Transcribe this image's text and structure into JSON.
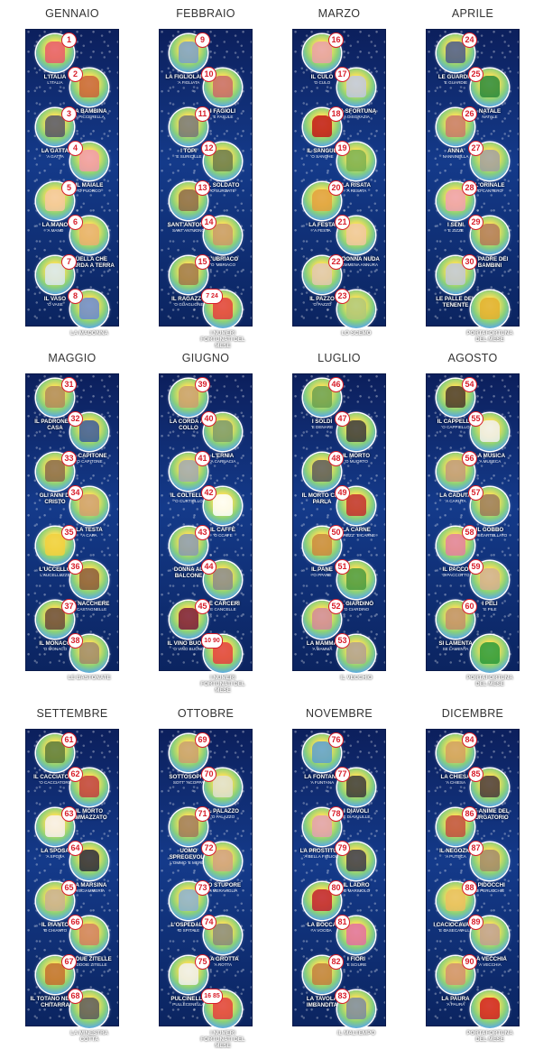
{
  "months": [
    {
      "name": "GENNAIO",
      "items": [
        {
          "num": "1",
          "label": "L'ITALIA",
          "sub": "L'ITALIA",
          "icon": "italy-icon",
          "color": "#e65b6b"
        },
        {
          "num": "2",
          "label": "LA BAMBINA",
          "sub": "'A PICCERELLA",
          "icon": "girl-icon",
          "color": "#c8643a"
        },
        {
          "num": "3",
          "label": "LA GATTA",
          "sub": "'A GATTA",
          "icon": "cat-icon",
          "color": "#555566"
        },
        {
          "num": "4",
          "label": "IL MAIALE",
          "sub": "'O PUORCO",
          "icon": "pig-icon",
          "color": "#f09aaa"
        },
        {
          "num": "5",
          "label": "LA MANO",
          "sub": "'A MANO",
          "icon": "hand-icon",
          "color": "#f4c8a0"
        },
        {
          "num": "6",
          "label": "QUELLA CHE GUARDA A TERRA",
          "sub": "",
          "icon": "woman-icon",
          "color": "#e8b070"
        },
        {
          "num": "7",
          "label": "IL VASO",
          "sub": "'O VASE",
          "icon": "vase-icon",
          "color": "#d8e8f0"
        },
        {
          "num": "8",
          "label": "LA MADONNA",
          "sub": "'A MARONNA",
          "icon": "madonna-icon",
          "color": "#6a8ad0"
        }
      ]
    },
    {
      "name": "FEBBRAIO",
      "items": [
        {
          "num": "9",
          "label": "LA FIGLIOLANZA",
          "sub": "'A FIGLIATA",
          "icon": "family-icon",
          "color": "#7aa0c8"
        },
        {
          "num": "10",
          "label": "I FAGIOLI",
          "sub": "'E FASULE",
          "icon": "beans-icon",
          "color": "#c86a6a"
        },
        {
          "num": "11",
          "label": "I TOPI",
          "sub": "'E SURICILLE",
          "icon": "mouse-icon",
          "color": "#777777"
        },
        {
          "num": "12",
          "label": "IL SOLDATO",
          "sub": "'O SURDATE",
          "icon": "soldier-icon",
          "color": "#6a7a4a"
        },
        {
          "num": "13",
          "label": "SANT'ANTONIO",
          "sub": "SANT'ANTUONO",
          "icon": "saint-icon",
          "color": "#8a6a4a"
        },
        {
          "num": "14",
          "label": "L'UBRIACO",
          "sub": "'O 'MBRIACO",
          "icon": "drunk-icon",
          "color": "#c89a6a"
        },
        {
          "num": "15",
          "label": "IL RAGAZZO",
          "sub": "'O GUAGLIONE",
          "icon": "boy-icon",
          "color": "#a0784a"
        },
        {
          "num": "7 24",
          "label": "I NUMERI FORTUNATI DEL MESE",
          "sub": "",
          "icon": "lucky-icon",
          "color": "#e04040"
        }
      ]
    },
    {
      "name": "MARZO",
      "items": [
        {
          "num": "16",
          "label": "IL CULO",
          "sub": "'O CULO",
          "icon": "bottom-icon",
          "color": "#e8a0a8"
        },
        {
          "num": "17",
          "label": "LA SFORTUNA",
          "sub": "'A DISGRAZIA",
          "icon": "misfortune-icon",
          "color": "#c0c8e0"
        },
        {
          "num": "18",
          "label": "IL SANGUE",
          "sub": "'O SANGHE",
          "icon": "blood-icon",
          "color": "#c01818"
        },
        {
          "num": "19",
          "label": "LA RISATA",
          "sub": "'A RESATA",
          "icon": "laugh-icon",
          "color": "#7ab050"
        },
        {
          "num": "20",
          "label": "LA FESTA",
          "sub": "'A FESTA",
          "icon": "party-icon",
          "color": "#e0a040"
        },
        {
          "num": "21",
          "label": "LA DONNA NUDA",
          "sub": "'A FEMMENA ANNURA",
          "icon": "nude-icon",
          "color": "#f0c8a0"
        },
        {
          "num": "22",
          "label": "IL PAZZO",
          "sub": "'O PAZZO",
          "icon": "crazy-icon",
          "color": "#e0c8b0"
        },
        {
          "num": "23",
          "label": "LO SCEMO",
          "sub": "'O SCEMO",
          "icon": "fool-icon",
          "color": "#b0c878"
        }
      ]
    },
    {
      "name": "APRILE",
      "items": [
        {
          "num": "24",
          "label": "LE GUARDIE",
          "sub": "'E GUARDIE",
          "icon": "guards-icon",
          "color": "#4a5a8a"
        },
        {
          "num": "25",
          "label": "NATALE",
          "sub": "NATALE",
          "icon": "christmas-tree-icon",
          "color": "#2a8a3a"
        },
        {
          "num": "26",
          "label": "ANNA",
          "sub": "NANNINELLA",
          "icon": "anna-icon",
          "color": "#c87a6a"
        },
        {
          "num": "27",
          "label": "L'ORINALE",
          "sub": "'O CANTERO",
          "icon": "chamberpot-icon",
          "color": "#a0a0a0"
        },
        {
          "num": "28",
          "label": "I SENI",
          "sub": "'E ZIZZE",
          "icon": "breasts-icon",
          "color": "#f0a0b0"
        },
        {
          "num": "29",
          "label": "IL PADRE DEI BAMBINI",
          "sub": "",
          "icon": "father-icon",
          "color": "#b07a5a"
        },
        {
          "num": "30",
          "label": "LE PALLE DEL TENENTE",
          "sub": "",
          "icon": "balls-icon",
          "color": "#c0c8d8"
        },
        {
          "num": "",
          "label": "PORTAFORTUNA DEL MESE",
          "sub": "",
          "icon": "horseshoe-icon",
          "color": "#e0b030"
        }
      ]
    },
    {
      "name": "MAGGIO",
      "items": [
        {
          "num": "31",
          "label": "IL PADRONE DI CASA",
          "sub": "",
          "icon": "landlord-icon",
          "color": "#b08a5a"
        },
        {
          "num": "32",
          "label": "IL CAPITONE",
          "sub": "'O CAPITONE",
          "icon": "eel-icon",
          "color": "#3a5a9a"
        },
        {
          "num": "33",
          "label": "GLI ANNI DI CRISTO",
          "sub": "",
          "icon": "christ-icon",
          "color": "#8a6a4a"
        },
        {
          "num": "34",
          "label": "LA TESTA",
          "sub": "'A CAPA",
          "icon": "head-icon",
          "color": "#d0a070"
        },
        {
          "num": "35",
          "label": "L'UCCELLO",
          "sub": "L'AUCELLUZZE",
          "icon": "bird-icon",
          "color": "#f0d040"
        },
        {
          "num": "36",
          "label": "LE NACCHERE",
          "sub": "'E CASTAGNELLE",
          "icon": "castanets-icon",
          "color": "#8a5a3a"
        },
        {
          "num": "37",
          "label": "IL MONACO",
          "sub": "'O MONACO",
          "icon": "monk-icon",
          "color": "#6a4a3a"
        },
        {
          "num": "38",
          "label": "LE BASTONATE",
          "sub": "'E MAZZATE",
          "icon": "beating-icon",
          "color": "#a08a6a"
        }
      ]
    },
    {
      "name": "GIUGNO",
      "items": [
        {
          "num": "39",
          "label": "LA CORDA AL COLLO",
          "sub": "",
          "icon": "rope-icon",
          "color": "#c8a070"
        },
        {
          "num": "40",
          "label": "L'ERNIA",
          "sub": "'A CARNACIA",
          "icon": "hernia-icon",
          "color": "#7a9a6a"
        },
        {
          "num": "41",
          "label": "IL COLTELLO",
          "sub": "'O CURTIELLO",
          "icon": "knife-icon",
          "color": "#a0a8b0"
        },
        {
          "num": "42",
          "label": "IL CAFFÈ",
          "sub": "'O CCAFE",
          "icon": "coffee-icon",
          "color": "#ffffff"
        },
        {
          "num": "43",
          "label": "DONNA AL BALCONE",
          "sub": "",
          "icon": "balcony-icon",
          "color": "#8a9ab0"
        },
        {
          "num": "44",
          "label": "LE CARCERI",
          "sub": "'E CANCELLE",
          "icon": "jail-icon",
          "color": "#8a8a8a"
        },
        {
          "num": "45",
          "label": "IL VINO BUONO",
          "sub": "'O VINO BUONO",
          "icon": "wine-icon",
          "color": "#7a1a3a"
        },
        {
          "num": "10 90",
          "label": "I NUMERI FORTUNATI DEL MESE",
          "sub": "",
          "icon": "lucky-icon",
          "color": "#e04040"
        }
      ]
    },
    {
      "name": "LUGLIO",
      "items": [
        {
          "num": "46",
          "label": "I SOLDI",
          "sub": "'E DENARE",
          "icon": "money-icon",
          "color": "#6aa050"
        },
        {
          "num": "47",
          "label": "IL MORTO",
          "sub": "'O MUORTO",
          "icon": "coffin-icon",
          "color": "#3a3a3a"
        },
        {
          "num": "48",
          "label": "IL MORTO CHE PARLA",
          "sub": "",
          "icon": "talking-dead-icon",
          "color": "#5a5a5a"
        },
        {
          "num": "49",
          "label": "LA CARNE",
          "sub": "'O PIEZZ' 'E CARNE",
          "icon": "meat-icon",
          "color": "#c03030"
        },
        {
          "num": "50",
          "label": "IL PANE",
          "sub": "'O PPANE",
          "icon": "bread-icon",
          "color": "#c88a40"
        },
        {
          "num": "51",
          "label": "IL GIARDINO",
          "sub": "'O CIARDINO",
          "icon": "garden-icon",
          "color": "#4a9a40"
        },
        {
          "num": "52",
          "label": "LA MAMMA",
          "sub": "'A MAMMA",
          "icon": "mother-icon",
          "color": "#d08a9a"
        },
        {
          "num": "53",
          "label": "IL VECCHIO",
          "sub": "'O VIECCHIO",
          "icon": "old-man-icon",
          "color": "#b0a090"
        }
      ]
    },
    {
      "name": "AGOSTO",
      "items": [
        {
          "num": "54",
          "label": "IL CAPPELLO",
          "sub": "'O CAPPIELLO",
          "icon": "hat-icon",
          "color": "#4a3a2a"
        },
        {
          "num": "55",
          "label": "LA MUSICA",
          "sub": "'A MUSECA",
          "icon": "music-icon",
          "color": "#f0f0f0"
        },
        {
          "num": "56",
          "label": "LA CADUTA",
          "sub": "'A CARUTA",
          "icon": "fall-icon",
          "color": "#c09a7a"
        },
        {
          "num": "57",
          "label": "IL GOBBO",
          "sub": "'O SCARTELLATO",
          "icon": "hunchback-icon",
          "color": "#9a7a5a"
        },
        {
          "num": "58",
          "label": "IL PACCO",
          "sub": "'O PACCOTTO",
          "icon": "gift-icon",
          "color": "#e080a0"
        },
        {
          "num": "59",
          "label": "I PELI",
          "sub": "'E PILE",
          "icon": "hair-icon",
          "color": "#d0b090"
        },
        {
          "num": "60",
          "label": "SI LAMENTA",
          "sub": "SE LAMENTA",
          "icon": "complain-icon",
          "color": "#c0906a"
        },
        {
          "num": "",
          "label": "PORTAFORTUNA DEL MESE",
          "sub": "",
          "icon": "clover-icon",
          "color": "#2a9a3a"
        }
      ]
    },
    {
      "name": "SETTEMBRE",
      "items": [
        {
          "num": "61",
          "label": "IL CACCIATORE",
          "sub": "'O CACCIATORE",
          "icon": "hunter-icon",
          "color": "#5a7a3a"
        },
        {
          "num": "62",
          "label": "IL MORTO AMMAZZATO",
          "sub": "",
          "icon": "murdered-icon",
          "color": "#c04040"
        },
        {
          "num": "63",
          "label": "LA SPOSA",
          "sub": "'A SPOSA",
          "icon": "bride-icon",
          "color": "#f8f0f0"
        },
        {
          "num": "64",
          "label": "LA MARSINA",
          "sub": "'A SCIAMMERIA",
          "icon": "tailcoat-icon",
          "color": "#2a2a3a"
        },
        {
          "num": "65",
          "label": "IL PIANTO",
          "sub": "'O CHIANTO",
          "icon": "crying-icon",
          "color": "#c8b090"
        },
        {
          "num": "66",
          "label": "LE DUE ZITELLE",
          "sub": "'E DDOIE ZITELLE",
          "icon": "spinsters-icon",
          "color": "#d08060"
        },
        {
          "num": "67",
          "label": "IL TOTANO NELLA CHITARRA",
          "sub": "",
          "icon": "squid-guitar-icon",
          "color": "#c07030"
        },
        {
          "num": "68",
          "label": "LA MINESTRA COTTA",
          "sub": "'A ZUPPA COTTA",
          "icon": "soup-icon",
          "color": "#5a5a5a"
        }
      ]
    },
    {
      "name": "OTTOBRE",
      "items": [
        {
          "num": "69",
          "label": "SOTTOSOPRA",
          "sub": "SOTT' 'NCOPPA",
          "icon": "upside-down-icon",
          "color": "#c8a070"
        },
        {
          "num": "70",
          "label": "IL PALAZZO",
          "sub": "'O PALAZZO",
          "icon": "palace-icon",
          "color": "#e0e0d0"
        },
        {
          "num": "71",
          "label": "UOMO SPREGEVOLE",
          "sub": "L'OMMO 'E MERDA",
          "icon": "despicable-icon",
          "color": "#a07a5a"
        },
        {
          "num": "72",
          "label": "LO STUPORE",
          "sub": "'A MERAVIGLIA",
          "icon": "amazement-icon",
          "color": "#d0a080"
        },
        {
          "num": "73",
          "label": "L'OSPEDALE",
          "sub": "'O SPITALE",
          "icon": "hospital-icon",
          "color": "#8ab0d0"
        },
        {
          "num": "74",
          "label": "LA GROTTA",
          "sub": "'A ROTTA",
          "icon": "cave-icon",
          "color": "#8a8a7a"
        },
        {
          "num": "75",
          "label": "PULCINELLA",
          "sub": "PULLECENELLA",
          "icon": "pulcinella-icon",
          "color": "#f0f0f0"
        },
        {
          "num": "16 85",
          "label": "I NUMERI FORTUNATI DEL MESE",
          "sub": "",
          "icon": "lucky-icon",
          "color": "#e04040"
        }
      ]
    },
    {
      "name": "NOVEMBRE",
      "items": [
        {
          "num": "76",
          "label": "LA FONTANA",
          "sub": "'A FUNTANA",
          "icon": "fountain-icon",
          "color": "#5aa0d0"
        },
        {
          "num": "77",
          "label": "I DIAVOLI",
          "sub": "'E DIAVULILLE",
          "icon": "devils-icon",
          "color": "#3a3a3a"
        },
        {
          "num": "78",
          "label": "LA PROSTITUTA",
          "sub": "'A BELLA FIGLIOLA",
          "icon": "lady-icon",
          "color": "#e0a0b0"
        },
        {
          "num": "79",
          "label": "IL LADRO",
          "sub": "'O MARIUOLO",
          "icon": "thief-icon",
          "color": "#3a3a4a"
        },
        {
          "num": "80",
          "label": "LA BOCCA",
          "sub": "'A VOCCA",
          "icon": "mouth-icon",
          "color": "#c02030"
        },
        {
          "num": "81",
          "label": "I FIORI",
          "sub": "'E SCIURE",
          "icon": "flowers-icon",
          "color": "#e070a0"
        },
        {
          "num": "82",
          "label": "LA TAVOLA IMBANDITA",
          "sub": "",
          "icon": "table-icon",
          "color": "#c08040"
        },
        {
          "num": "83",
          "label": "IL MALTEMPO",
          "sub": "'O MALETIEMPO",
          "icon": "bad-weather-icon",
          "color": "#7a8aa0"
        }
      ]
    },
    {
      "name": "DICEMBRE",
      "items": [
        {
          "num": "84",
          "label": "LA CHIESA",
          "sub": "'A CHIESA",
          "icon": "church-icon",
          "color": "#d0a060"
        },
        {
          "num": "85",
          "label": "LE ANIME DEL PURGATORIO",
          "sub": "",
          "icon": "souls-icon",
          "color": "#4a3a3a"
        },
        {
          "num": "86",
          "label": "IL NEGOZIO",
          "sub": "'A PUTECA",
          "icon": "shop-icon",
          "color": "#c05040"
        },
        {
          "num": "87",
          "label": "I PIDOCCHI",
          "sub": "'E PERUCCHIE",
          "icon": "lice-icon",
          "color": "#a08a6a"
        },
        {
          "num": "88",
          "label": "I CACIOCAVALLI",
          "sub": "'E CASECAVALLE",
          "icon": "cheese-icon",
          "color": "#e8c060"
        },
        {
          "num": "89",
          "label": "LA VECCHIA",
          "sub": "'A VECCHIA",
          "icon": "old-woman-icon",
          "color": "#c0a090"
        },
        {
          "num": "90",
          "label": "LA PAURA",
          "sub": "'A PAURA",
          "icon": "fear-icon",
          "color": "#d09070"
        },
        {
          "num": "",
          "label": "PORTAFORTUNA DEL MESE",
          "sub": "",
          "icon": "horn-icon",
          "color": "#d02020"
        }
      ]
    }
  ]
}
